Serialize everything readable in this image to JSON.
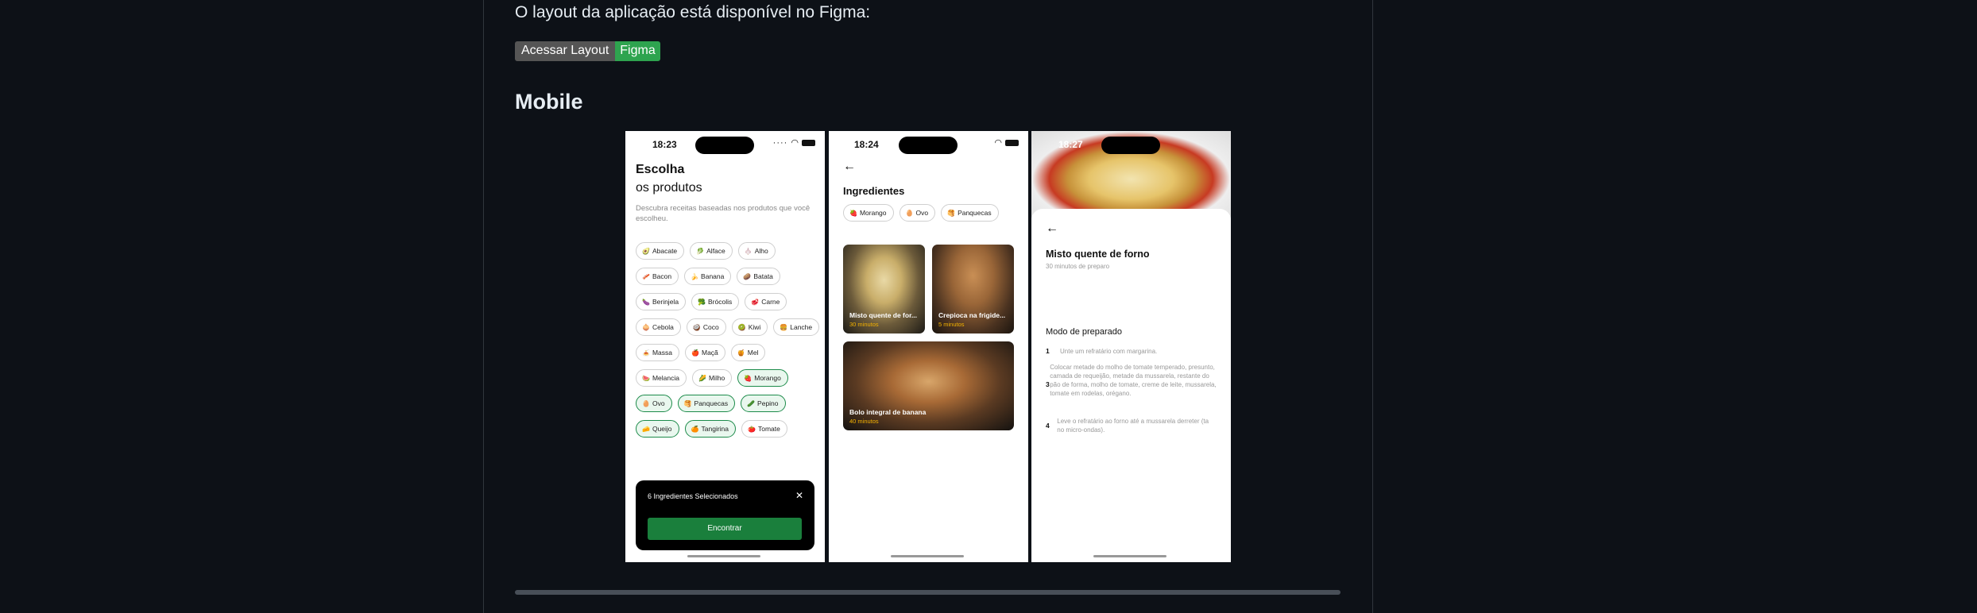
{
  "readme": {
    "intro": "O layout da aplicação está disponível no Figma:",
    "badge_label": "Acessar Layout",
    "badge_value": "Figma",
    "section_title": "Mobile"
  },
  "screen1": {
    "time": "18:23",
    "title": "Escolha",
    "subtitle": "os produtos",
    "description": "Descubra receitas baseadas nos produtos que você escolheu.",
    "ingredients": [
      {
        "emoji": "🥑",
        "name": "Abacate",
        "selected": false
      },
      {
        "emoji": "🥬",
        "name": "Alface",
        "selected": false
      },
      {
        "emoji": "🧄",
        "name": "Alho",
        "selected": false
      },
      {
        "emoji": "🥓",
        "name": "Bacon",
        "selected": false
      },
      {
        "emoji": "🍌",
        "name": "Banana",
        "selected": false
      },
      {
        "emoji": "🥔",
        "name": "Batata",
        "selected": false
      },
      {
        "emoji": "🍆",
        "name": "Berinjela",
        "selected": false
      },
      {
        "emoji": "🥦",
        "name": "Brócolis",
        "selected": false
      },
      {
        "emoji": "🥩",
        "name": "Carne",
        "selected": false
      },
      {
        "emoji": "🧅",
        "name": "Cebola",
        "selected": false
      },
      {
        "emoji": "🥥",
        "name": "Coco",
        "selected": false
      },
      {
        "emoji": "🥝",
        "name": "Kiwi",
        "selected": false
      },
      {
        "emoji": "🍔",
        "name": "Lanche",
        "selected": false
      },
      {
        "emoji": "🍝",
        "name": "Massa",
        "selected": false
      },
      {
        "emoji": "🍎",
        "name": "Maçã",
        "selected": false
      },
      {
        "emoji": "🍯",
        "name": "Mel",
        "selected": false
      },
      {
        "emoji": "🍉",
        "name": "Melancia",
        "selected": false
      },
      {
        "emoji": "🌽",
        "name": "Milho",
        "selected": false
      },
      {
        "emoji": "🍓",
        "name": "Morango",
        "selected": true
      },
      {
        "emoji": "🥚",
        "name": "Ovo",
        "selected": true
      },
      {
        "emoji": "🥞",
        "name": "Panquecas",
        "selected": true
      },
      {
        "emoji": "🥒",
        "name": "Pepino",
        "selected": true
      },
      {
        "emoji": "🧀",
        "name": "Queijo",
        "selected": true
      },
      {
        "emoji": "🍊",
        "name": "Tangirina",
        "selected": true
      },
      {
        "emoji": "🍅",
        "name": "Tomate",
        "selected": false
      }
    ],
    "selected_text": "6 Ingredientes Selecionados",
    "find_button": "Encontrar"
  },
  "screen2": {
    "time": "18:24",
    "heading": "Ingredientes",
    "filters": [
      {
        "emoji": "🍓",
        "name": "Morango"
      },
      {
        "emoji": "🥚",
        "name": "Ovo"
      },
      {
        "emoji": "🥞",
        "name": "Panquecas"
      }
    ],
    "recipes": [
      {
        "name": "Misto quente de for...",
        "time": "30 minutos"
      },
      {
        "name": "Crepioca na frigide...",
        "time": "5 minutos"
      },
      {
        "name": "Bolo integral de banana",
        "time": "40 minutos"
      }
    ]
  },
  "screen3": {
    "time": "18:27",
    "recipe_title": "Misto quente de forno",
    "recipe_time": "30 minutos de preparo",
    "method_title": "Modo de preparado",
    "steps": [
      {
        "n": "1",
        "text": "Unte um refratário com margarina."
      },
      {
        "n": "3",
        "text": "Colocar metade do molho de tomate temperado, presunto, camada de requeijão, metade da mussarela, restante do pão de forma, molho de tomate, creme de leite, mussarela, tomate em rodelas, orégano."
      },
      {
        "n": "4",
        "text": "Leve o refratário ao forno até a mussarela derreter (ta no micro-ondas)."
      }
    ]
  },
  "colors": {
    "green": "#1a7f3c",
    "accent": "#f5b300",
    "page_bg": "#0d1117"
  }
}
